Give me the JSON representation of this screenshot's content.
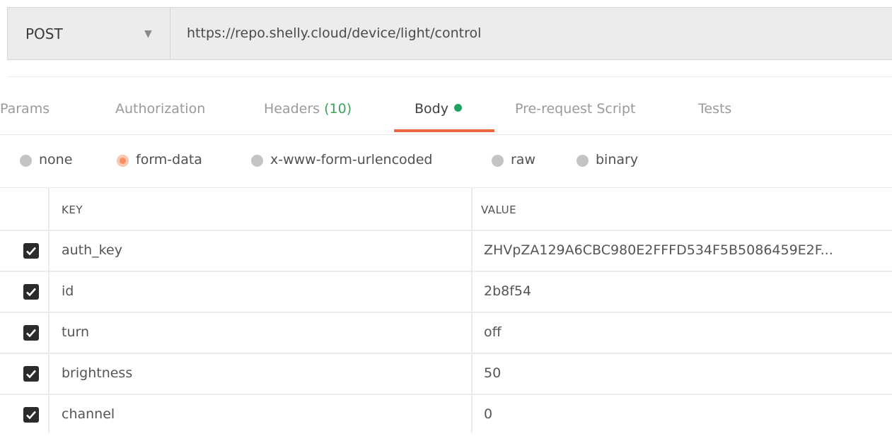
{
  "request": {
    "method": "POST",
    "url": "https://repo.shelly.cloud/device/light/control"
  },
  "tabs": [
    {
      "label": "Params"
    },
    {
      "label": "Authorization"
    },
    {
      "label": "Headers",
      "count": "(10)"
    },
    {
      "label": "Body"
    },
    {
      "label": "Pre-request Script"
    },
    {
      "label": "Tests"
    }
  ],
  "active_tab": "Body",
  "body_types": [
    "none",
    "form-data",
    "x-www-form-urlencoded",
    "raw",
    "binary"
  ],
  "selected_body_type": "form-data",
  "table": {
    "headers": {
      "key": "KEY",
      "value": "VALUE"
    },
    "rows": [
      {
        "key": "auth_key",
        "value": "ZHVpZA129A6CBC980E2FFFD534F5B5086459E2F...",
        "checked": true
      },
      {
        "key": "id",
        "value": "2b8f54",
        "checked": true
      },
      {
        "key": "turn",
        "value": "off",
        "checked": true
      },
      {
        "key": "brightness",
        "value": "50",
        "checked": true
      },
      {
        "key": "channel",
        "value": "0",
        "checked": true
      }
    ]
  },
  "colors": {
    "accent": "#e8683c",
    "count_green": "#3aa35a",
    "dot_green": "#20a060"
  }
}
